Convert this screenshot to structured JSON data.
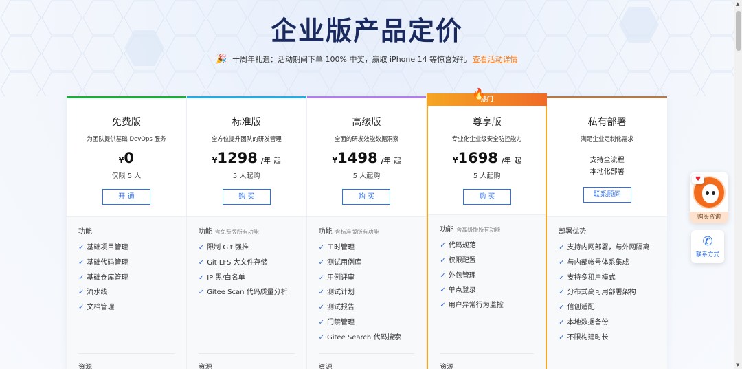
{
  "page": {
    "title": "企业版产品定价",
    "promo_text": "十周年礼遇：活动期间下单 100% 中奖，赢取 iPhone 14 等惊喜好礼",
    "promo_link": "查看活动详情"
  },
  "colors": {
    "free": "#1faa3c",
    "standard": "#2aa8e0",
    "advanced": "#b07ee8",
    "premium": "#f5a623",
    "private": "#b07a4c",
    "primary": "#2f6fe8"
  },
  "plans": [
    {
      "name": "免费版",
      "desc": "为团队提供基础 DevOps 服务",
      "yen": "¥",
      "price": "0",
      "unit": "",
      "suffix": "",
      "sub": "仅限 5 人",
      "button": "开 通",
      "features_title": "功能",
      "features_note": "",
      "features": [
        "基础项目管理",
        "基础代码管理",
        "基础仓库管理",
        "流水线",
        "文档管理"
      ],
      "resources_title": "资源"
    },
    {
      "name": "标准版",
      "desc": "全方位提升团队的研发管理",
      "yen": "¥",
      "price": "1298",
      "unit": "/年",
      "suffix": "起",
      "sub": "5 人起购",
      "button": "购 买",
      "features_title": "功能",
      "features_note": "含免费版所有功能",
      "features": [
        "限制 Git 强推",
        "Git LFS 大文件存储",
        "IP 黑/白名单",
        "Gitee Scan 代码质量分析"
      ],
      "resources_title": "资源"
    },
    {
      "name": "高级版",
      "desc": "全面的研发效能数据洞察",
      "yen": "¥",
      "price": "1498",
      "unit": "/年",
      "suffix": "起",
      "sub": "5 人起购",
      "button": "购 买",
      "features_title": "功能",
      "features_note": "含标准版所有功能",
      "features": [
        "工时管理",
        "测试用例库",
        "用例评审",
        "测试计划",
        "测试报告",
        "门禁管理",
        "Gitee Search 代码搜索"
      ],
      "resources_title": "资源"
    },
    {
      "name": "尊享版",
      "badge": "热门",
      "desc": "专业化企业级安全防控能力",
      "yen": "¥",
      "price": "1698",
      "unit": "/年",
      "suffix": "起",
      "sub": "5 人起购",
      "button": "购 买",
      "features_title": "功能",
      "features_note": "含高级版所有功能",
      "features": [
        "代码规范",
        "权限配置",
        "外包管理",
        "单点登录",
        "用户异常行为监控"
      ],
      "resources_title": "资源"
    },
    {
      "name": "私有部署",
      "desc": "满足企业定制化需求",
      "line1": "支持全流程",
      "line2": "本地化部署",
      "button": "联系顾问",
      "features_title": "部署优势",
      "features_note": "",
      "features": [
        "支持内网部署，与外网隔离",
        "与内部帐号体系集成",
        "支持多租户模式",
        "分布式高可用部署架构",
        "信创适配",
        "本地数据备份",
        "不限构建时长"
      ]
    }
  ],
  "side": {
    "consult_label": "购买咨询",
    "contact_label": "联系方式"
  }
}
